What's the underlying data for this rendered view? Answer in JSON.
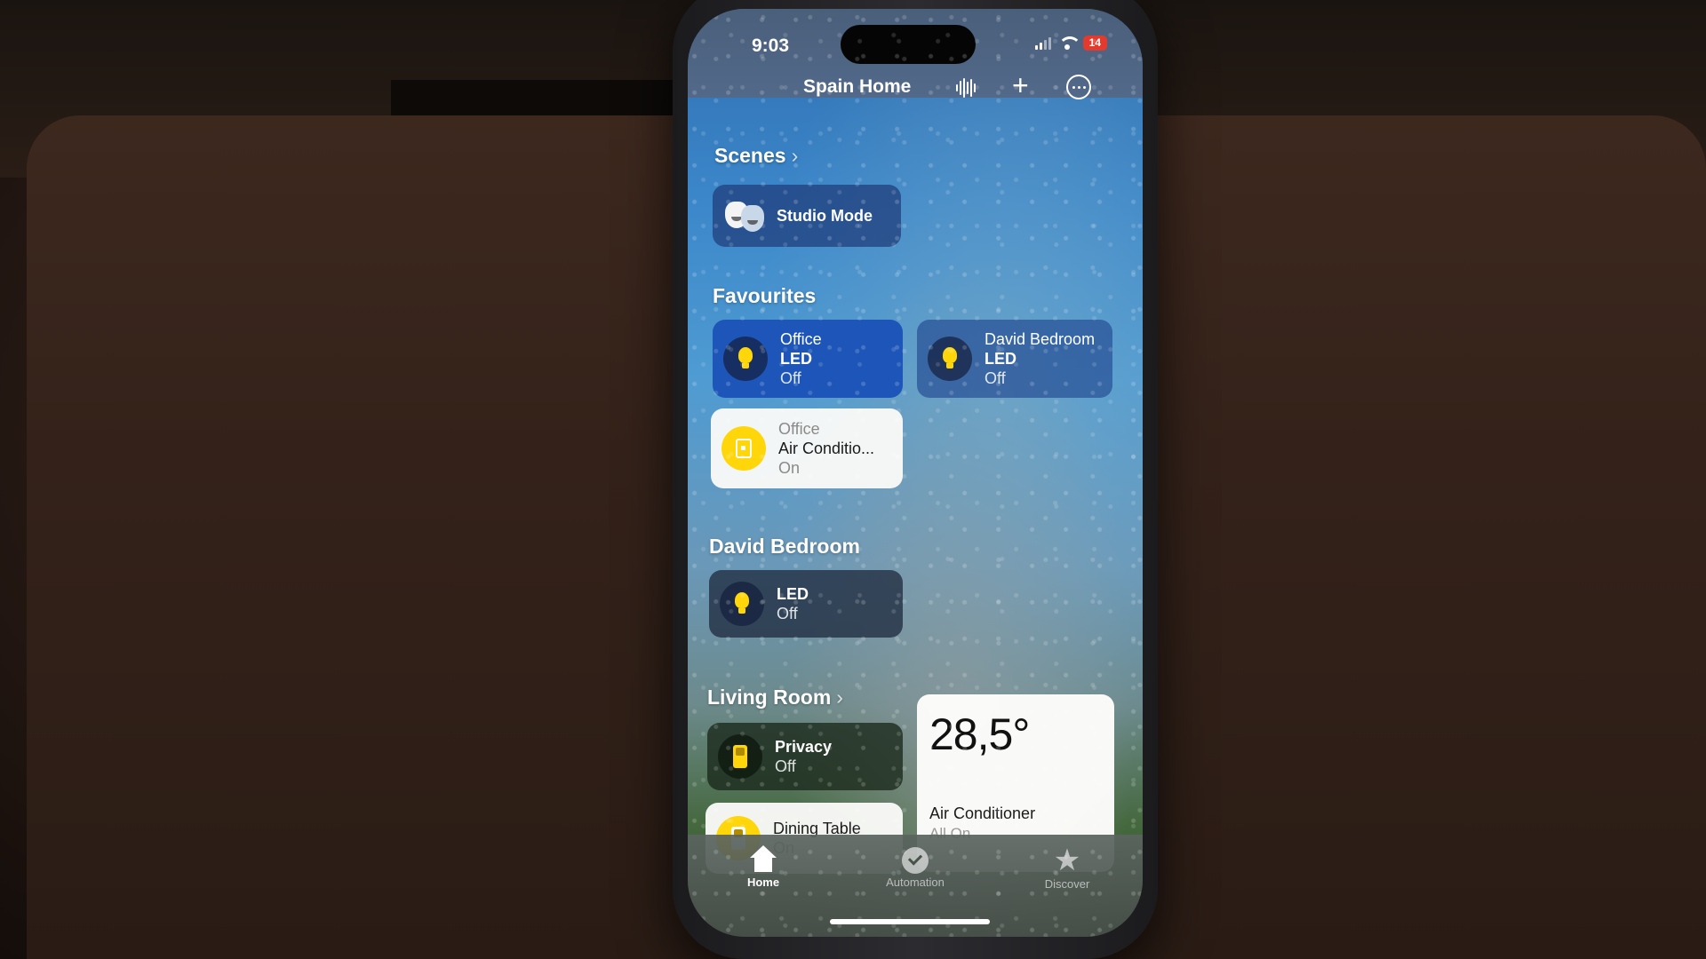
{
  "status": {
    "time": "9:03",
    "battery": "14"
  },
  "header": {
    "home_title": "Spain Home"
  },
  "scenes": {
    "title": "Scenes",
    "chevron": "›",
    "items": [
      {
        "label": "Studio Mode",
        "icon": "theater-masks-icon"
      }
    ]
  },
  "favourites": {
    "title": "Favourites",
    "items": [
      {
        "room": "Office",
        "name": "LED",
        "state": "Off",
        "icon": "lightbulb-icon"
      },
      {
        "room": "David Bedroom",
        "name": "LED",
        "state": "Off",
        "icon": "lightbulb-icon"
      },
      {
        "room": "Office",
        "name": "Air Conditio...",
        "state": "On",
        "icon": "air-conditioner-icon"
      }
    ]
  },
  "david_bedroom": {
    "title": "David Bedroom",
    "items": [
      {
        "name": "LED",
        "state": "Off",
        "icon": "lightbulb-icon"
      }
    ]
  },
  "living_room": {
    "title": "Living Room",
    "chevron": "›",
    "items": [
      {
        "name": "Privacy",
        "state": "Off",
        "icon": "switch-icon"
      },
      {
        "name": "Dining Table",
        "state": "On",
        "icon": "switch-icon"
      }
    ],
    "thermostat": {
      "value": "28,5°",
      "name": "Air Conditioner",
      "state": "All On"
    }
  },
  "tabbar": {
    "tabs": [
      {
        "label": "Home",
        "icon": "house-icon",
        "active": true
      },
      {
        "label": "Automation",
        "icon": "clock-check-icon",
        "active": false
      },
      {
        "label": "Discover",
        "icon": "star-icon",
        "active": false
      }
    ]
  },
  "colors": {
    "accent_yellow": "#ffd60a",
    "battery_red": "#e23b2e",
    "active_tile_blue": "#1d56b8"
  }
}
